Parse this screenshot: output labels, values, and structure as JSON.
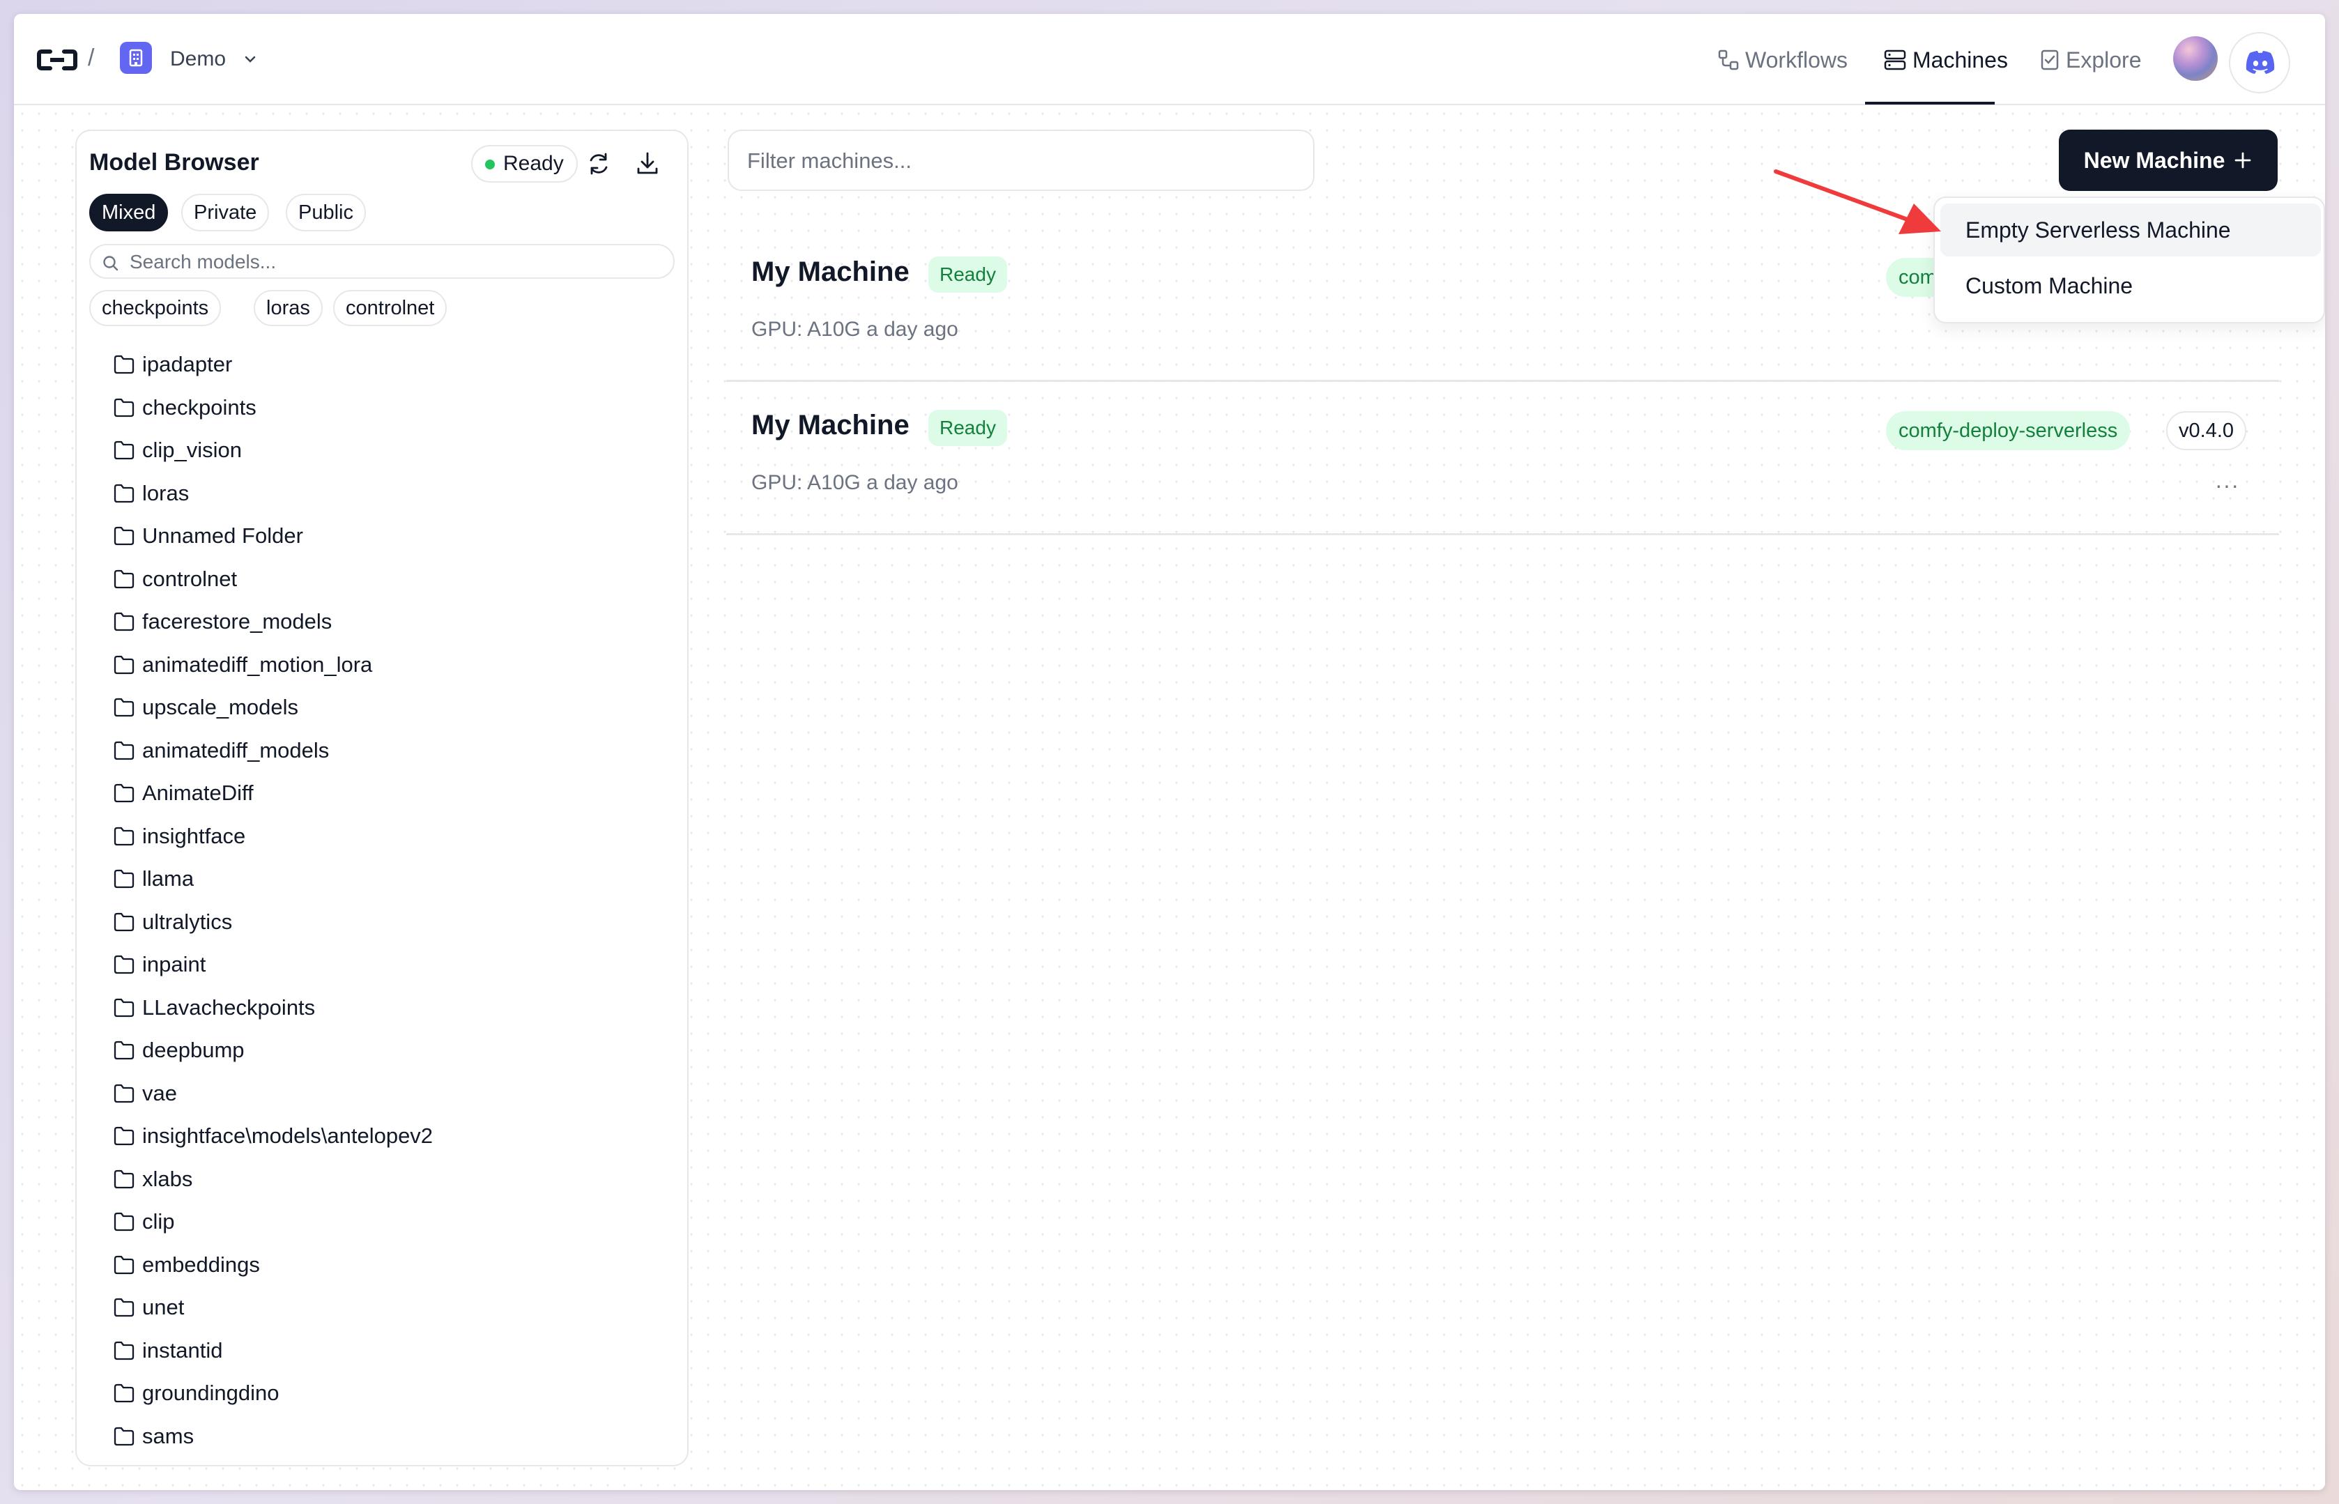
{
  "header": {
    "breadcrumb_sep": "/",
    "org_name": "Demo",
    "nav": [
      {
        "label": "Workflows",
        "icon": "workflow-icon"
      },
      {
        "label": "Machines",
        "icon": "server-icon",
        "active": true
      },
      {
        "label": "Explore",
        "icon": "checklist-icon"
      }
    ]
  },
  "model_browser": {
    "title": "Model Browser",
    "status": "Ready",
    "segments": [
      "Mixed",
      "Private",
      "Public"
    ],
    "active_segment": "Mixed",
    "search_placeholder": "Search models...",
    "chips": [
      "checkpoints",
      "loras",
      "controlnet"
    ],
    "folders": [
      "ipadapter",
      "checkpoints",
      "clip_vision",
      "loras",
      "Unnamed Folder",
      "controlnet",
      "facerestore_models",
      "animatediff_motion_lora",
      "upscale_models",
      "animatediff_models",
      "AnimateDiff",
      "insightface",
      "llama",
      "ultralytics",
      "inpaint",
      "LLavacheckpoints",
      "deepbump",
      "vae",
      "insightface\\models\\antelopev2",
      "xlabs",
      "clip",
      "embeddings",
      "unet",
      "instantid",
      "groundingdino",
      "sams"
    ]
  },
  "main": {
    "filter_placeholder": "Filter machines...",
    "new_machine_label": "New Machine",
    "machines": [
      {
        "name": "My Machine",
        "status": "Ready",
        "gpu": "GPU: A10G a day ago",
        "tag_visible": "comf"
      },
      {
        "name": "My Machine",
        "status": "Ready",
        "gpu": "GPU: A10G a day ago",
        "tag": "comfy-deploy-serverless",
        "version": "v0.4.0",
        "more": "···"
      }
    ],
    "dropdown": [
      "Empty Serverless Machine",
      "Custom Machine"
    ]
  },
  "colors": {
    "accent": "#111827",
    "ready_green": "#15803d",
    "ready_bg": "#dcfce7",
    "org_badge": "#6366f1",
    "discord": "#5865f2",
    "arrow": "#ef3b3b"
  }
}
